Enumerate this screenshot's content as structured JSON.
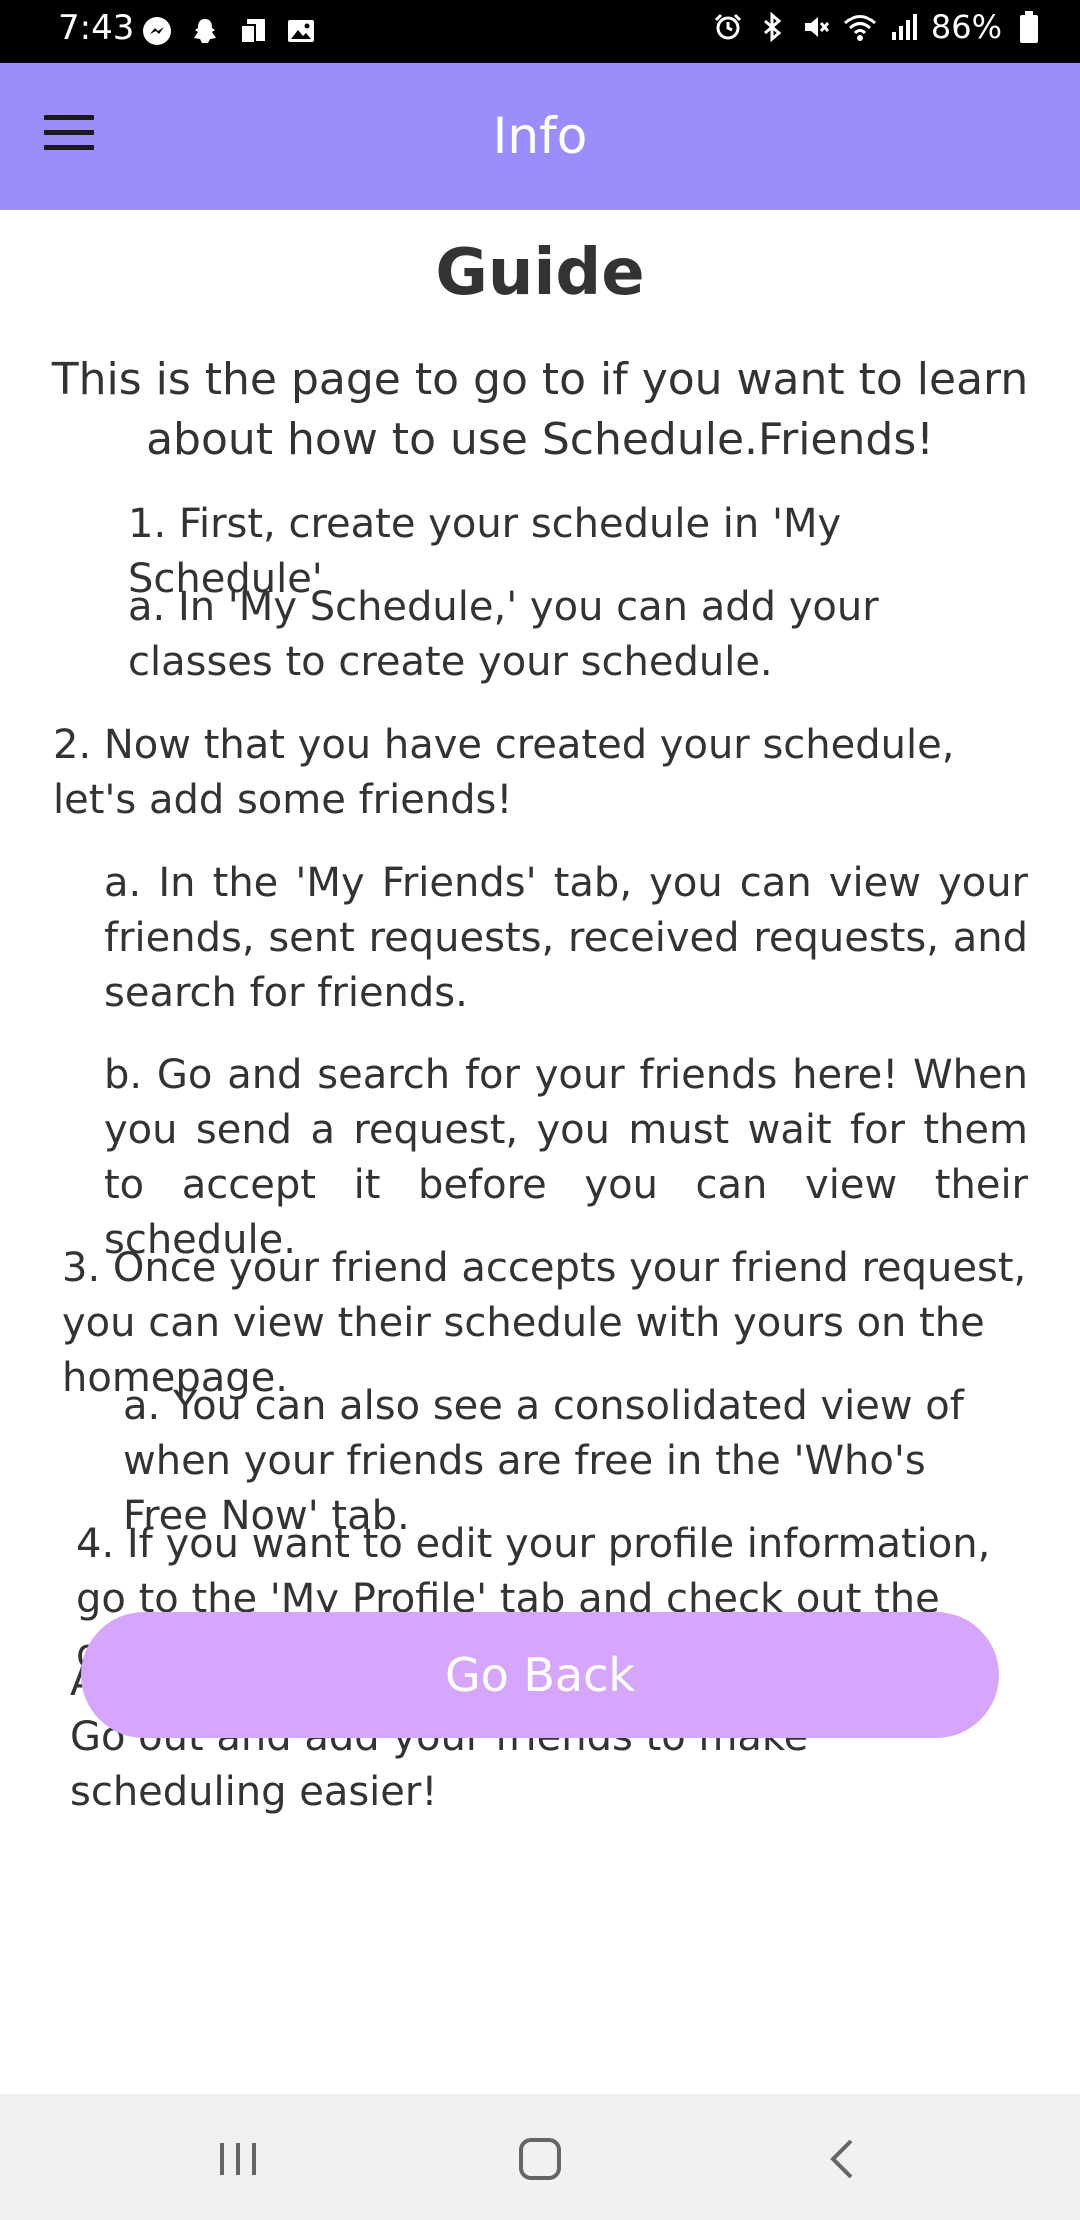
{
  "status_bar": {
    "time": "7:43",
    "battery": "86%",
    "left_icons": [
      "messenger-icon",
      "snapchat-icon",
      "device-icon",
      "image-icon"
    ],
    "right_icons": [
      "alarm-icon",
      "bluetooth-icon",
      "mute-icon",
      "wifi-icon",
      "signal-icon",
      "battery-icon"
    ]
  },
  "app_bar": {
    "title": "Info"
  },
  "guide": {
    "title": "Guide",
    "intro": "This is the page to go to if you want to learn about how to use Schedule.Friends!",
    "step1": "1. First, create your schedule in 'My Schedule'",
    "step1a": "a. In 'My Schedule,' you can add your classes to create your schedule.",
    "step2": "2. Now that you have created your schedule, let's add some friends!",
    "step2a": "a. In the 'My Friends' tab, you can view your friends, sent requests, received requests, and search for friends.",
    "step2b": "b. Go and search for your friends here! When you send a request, you must wait for them to accept it before you can view their schedule.",
    "step3": "3. Once your friend accepts your friend request, you can view their schedule with yours on the homepage.",
    "step3a": "a. You can also see a consolidated view of when your friends are free in the 'Who's Free Now' tab.",
    "step4": "4. If you want to edit your profile information, go to the 'My Profile' tab and check out the options there!",
    "outro": "And that's the main gist of Schedule.Friends! Go out and add your friends to make scheduling easier!"
  },
  "go_back_label": "Go Back",
  "colors": {
    "app_bar": "#9c8dfc",
    "button": "#d5a6fb",
    "status_bar": "#000000",
    "nav_bar": "#f1f1f1"
  }
}
